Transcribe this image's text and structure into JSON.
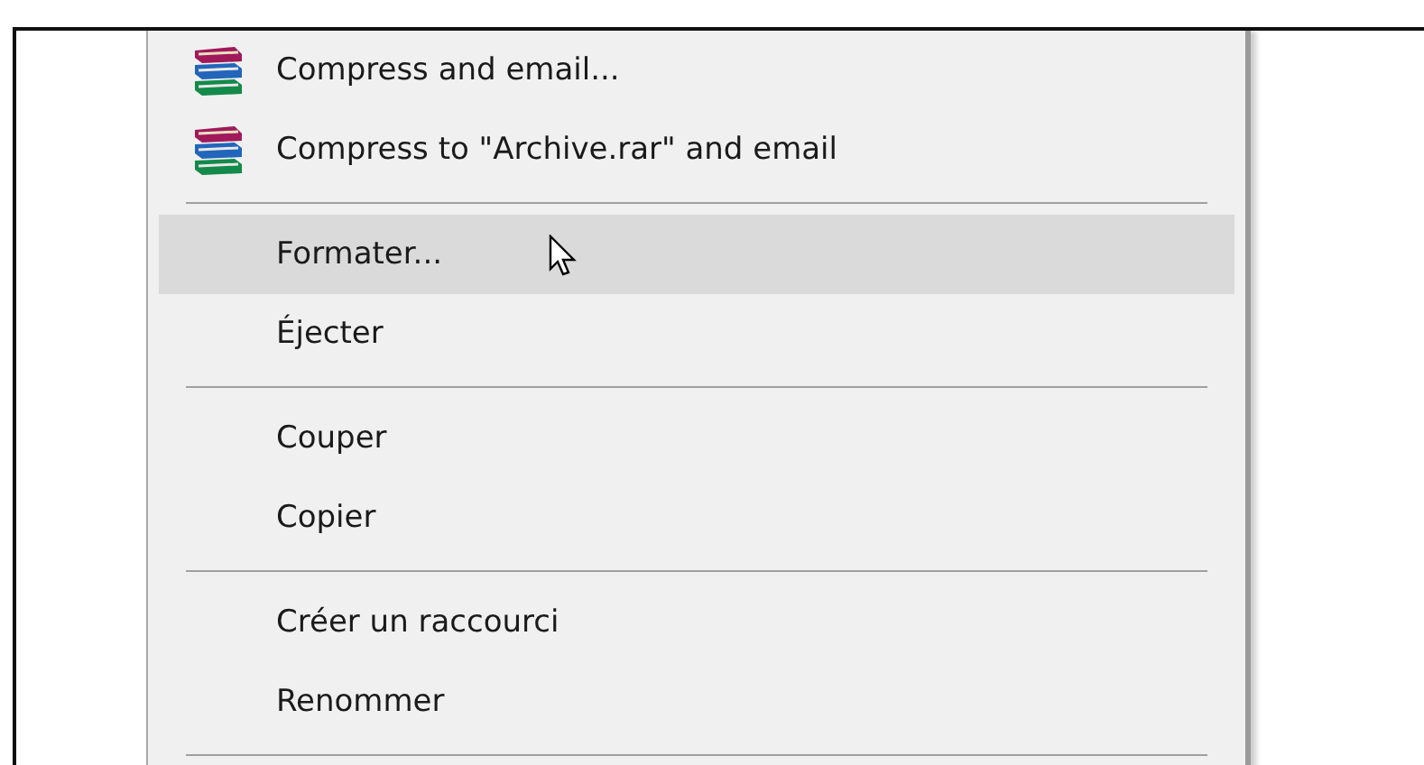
{
  "context_menu": {
    "items": [
      {
        "kind": "item",
        "label": "Compress and email...",
        "has_icon": true,
        "selected": false
      },
      {
        "kind": "item",
        "label": "Compress to \"Archive.rar\" and email",
        "has_icon": true,
        "selected": false
      },
      {
        "kind": "separator"
      },
      {
        "kind": "item",
        "label": "Formater...",
        "has_icon": false,
        "selected": true
      },
      {
        "kind": "item",
        "label": "Éjecter",
        "has_icon": false,
        "selected": false
      },
      {
        "kind": "separator"
      },
      {
        "kind": "item",
        "label": "Couper",
        "has_icon": false,
        "selected": false
      },
      {
        "kind": "item",
        "label": "Copier",
        "has_icon": false,
        "selected": false
      },
      {
        "kind": "separator"
      },
      {
        "kind": "item",
        "label": "Créer un raccourci",
        "has_icon": false,
        "selected": false
      },
      {
        "kind": "item",
        "label": "Renommer",
        "has_icon": false,
        "selected": false
      },
      {
        "kind": "separator"
      }
    ]
  }
}
